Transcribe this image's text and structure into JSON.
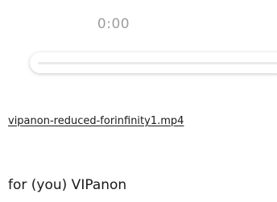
{
  "player": {
    "current_time": "0:00",
    "progress": 0
  },
  "file": {
    "name": "vipanon-reduced-forinfinity1.mp4"
  },
  "caption": "for (you) VIPanon"
}
